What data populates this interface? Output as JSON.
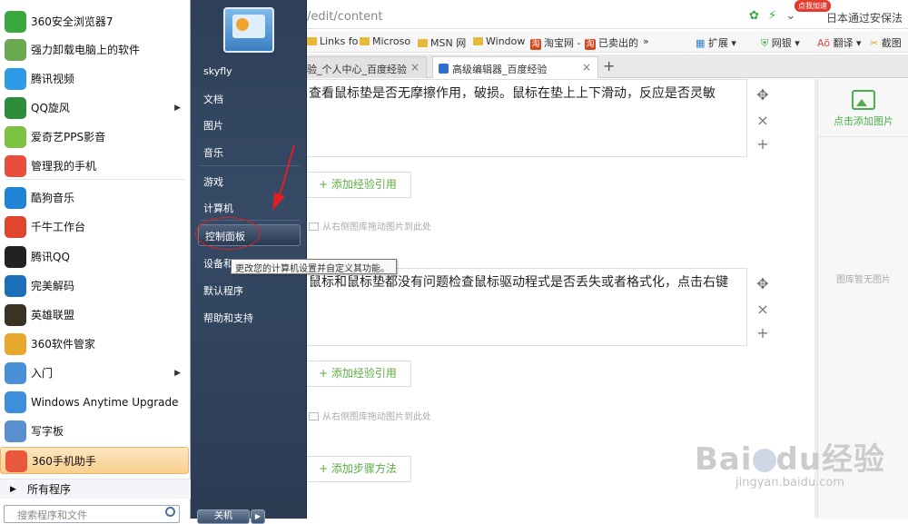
{
  "browser": {
    "address": "/edit/content",
    "address_right": "日本通过安保法",
    "badge": "点我加速",
    "bookmarks": [
      "Links fo",
      "Microso",
      "MSN 网",
      "Window",
      "淘宝网 -",
      "已卖出的",
      "»"
    ],
    "toolbar_right": [
      "扩展",
      "网银",
      "翻译",
      "截图"
    ],
    "tabs": [
      {
        "label": "经验_个人中心_百度经验",
        "active": false
      },
      {
        "label": "高级编辑器_百度经验",
        "active": true
      }
    ],
    "new_tab": "+"
  },
  "editor": {
    "step1_text": "查看鼠标垫是否无摩擦作用，破损。鼠标在垫上上下滑动，反应是否灵敏",
    "step2_text": "鼠标和鼠标垫都没有问题检查鼠标驱动程式是否丢失或者格式化，点击右键",
    "add_ref_label": "+ 添加经验引用",
    "drag_hint": "从右侧图库拖动图片到此处",
    "add_step_label": "+ 添加步骤方法",
    "ctrl_move": "✥",
    "ctrl_close": "×",
    "ctrl_add": "+",
    "side_add_image": "点击添加图片",
    "side_no_image": "图库暂无图片",
    "watermark": "Bai",
    "watermark_mid": "du",
    "watermark_cn": "经验",
    "watermark_sub": "jingyan.baidu.com"
  },
  "start_menu": {
    "programs": [
      {
        "label": "360安全浏览器7",
        "icon": "360-browser-icon",
        "color": "#3aa83f",
        "arrow": false
      },
      {
        "label": "强力卸载电脑上的软件",
        "icon": "uninstall-icon",
        "color": "#6aa84f",
        "arrow": false
      },
      {
        "label": "腾讯视频",
        "icon": "tencent-video-icon",
        "color": "#2e9be6",
        "arrow": false
      },
      {
        "label": "QQ旋风",
        "icon": "qq-whirlwind-icon",
        "color": "#2b8c3a",
        "arrow": true
      },
      {
        "label": "爱奇艺PPS影音",
        "icon": "iqiyi-icon",
        "color": "#7cc242",
        "arrow": false
      },
      {
        "label": "管理我的手机",
        "icon": "phone-manager-icon",
        "color": "#e94e3c",
        "arrow": false
      },
      {
        "label": "酷狗音乐",
        "icon": "kugou-icon",
        "color": "#1f84d6",
        "arrow": false
      },
      {
        "label": "千牛工作台",
        "icon": "qianniu-icon",
        "color": "#e0452e",
        "arrow": false
      },
      {
        "label": "腾讯QQ",
        "icon": "qq-icon",
        "color": "#222222",
        "arrow": false
      },
      {
        "label": "完美解码",
        "icon": "wanmei-icon",
        "color": "#1b6fb8",
        "arrow": false
      },
      {
        "label": "英雄联盟",
        "icon": "lol-icon",
        "color": "#3a3222",
        "arrow": false
      },
      {
        "label": "360软件管家",
        "icon": "360-softmgr-icon",
        "color": "#e8a82b",
        "arrow": false
      },
      {
        "label": "入门",
        "icon": "getting-started-icon",
        "color": "#4a90d9",
        "arrow": true
      },
      {
        "label": "Windows Anytime Upgrade",
        "icon": "windows-logo-icon",
        "color": "#3c8fd8",
        "arrow": false
      },
      {
        "label": "写字板",
        "icon": "wordpad-icon",
        "color": "#5a8fcf",
        "arrow": false
      },
      {
        "label": "360手机助手",
        "icon": "360-phone-icon",
        "color": "#e9583c",
        "arrow": false
      }
    ],
    "all_programs": "所有程序",
    "search_placeholder": "搜索程序和文件",
    "right_items": [
      "skyfly",
      "文档",
      "图片",
      "音乐",
      "游戏",
      "计算机",
      "控制面板",
      "设备和",
      "默认程序",
      "帮助和支持"
    ],
    "tooltip": "更改您的计算机设置并自定义其功能。",
    "shutdown": "关机",
    "shutdown_arrow": "▶"
  },
  "colors": {
    "start_right_pane": "#2e3f57",
    "highlight_orange": "#f9cf8e",
    "accent_green": "#5aac44",
    "annotation_red": "#e02020"
  }
}
